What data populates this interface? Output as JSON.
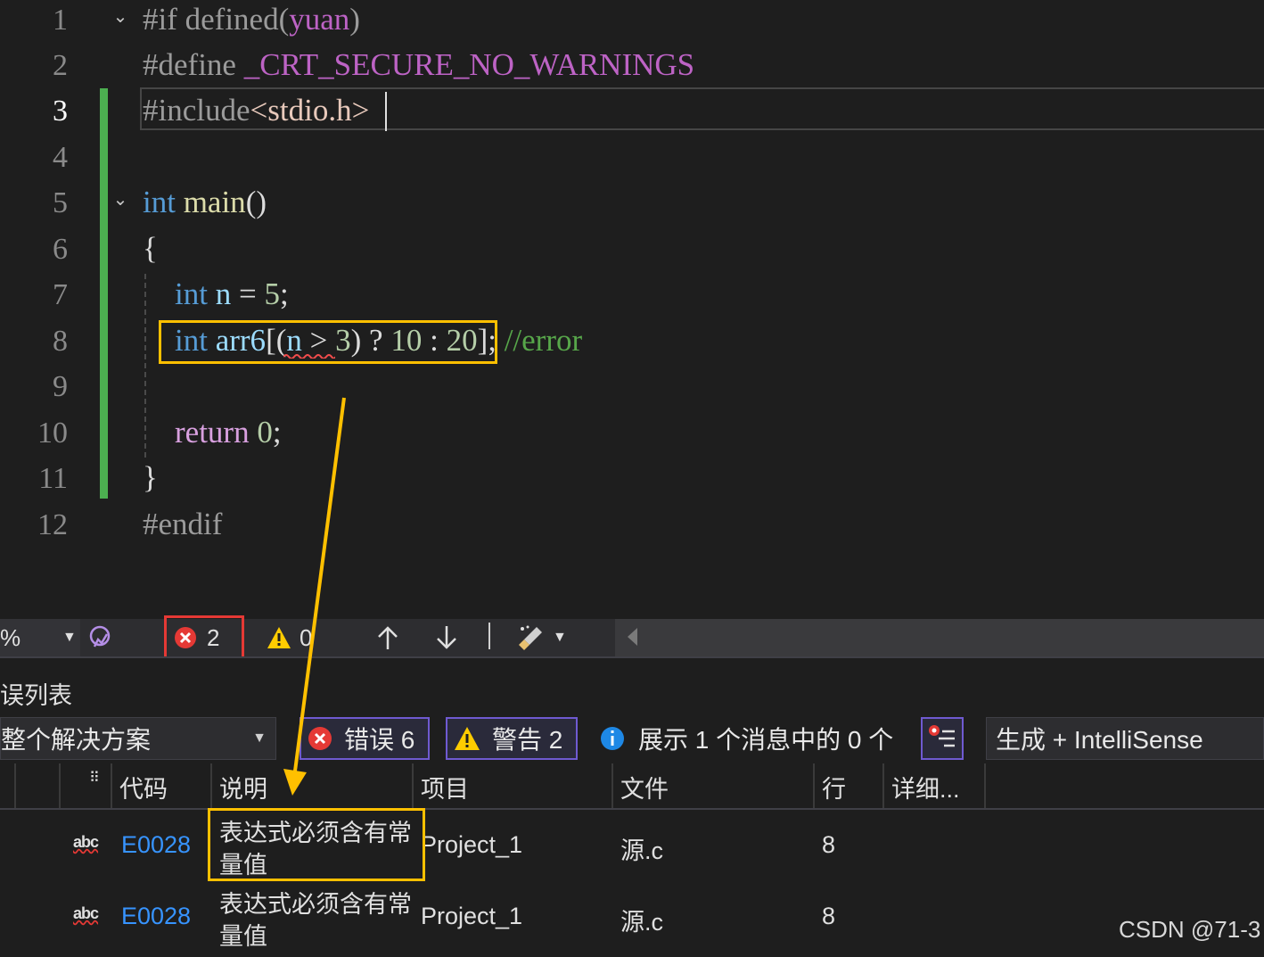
{
  "editor": {
    "lines": [
      {
        "num": "1",
        "tokens": [
          {
            "t": "#if defined(",
            "c": "c-pre"
          },
          {
            "t": "yuan",
            "c": "c-macro"
          },
          {
            "t": ")",
            "c": "c-pre"
          }
        ]
      },
      {
        "num": "2",
        "tokens": [
          {
            "t": "#define ",
            "c": "c-pre"
          },
          {
            "t": "_CRT_SECURE_NO_WARNINGS",
            "c": "c-macro"
          }
        ]
      },
      {
        "num": "3",
        "tokens": [
          {
            "t": "#include",
            "c": "c-pre"
          },
          {
            "t": "<stdio.h>",
            "c": "c-str"
          }
        ]
      },
      {
        "num": "4",
        "tokens": []
      },
      {
        "num": "5",
        "tokens": [
          {
            "t": "int",
            "c": "c-kw"
          },
          {
            "t": " ",
            "c": "c-plain"
          },
          {
            "t": "main",
            "c": "c-fn"
          },
          {
            "t": "()",
            "c": "c-plain"
          }
        ]
      },
      {
        "num": "6",
        "tokens": [
          {
            "t": "{",
            "c": "c-plain"
          }
        ]
      },
      {
        "num": "7",
        "tokens": [
          {
            "t": "int",
            "c": "c-kw"
          },
          {
            "t": " ",
            "c": "c-plain"
          },
          {
            "t": "n",
            "c": "c-var"
          },
          {
            "t": " = ",
            "c": "c-plain"
          },
          {
            "t": "5",
            "c": "c-num"
          },
          {
            "t": ";",
            "c": "c-plain"
          }
        ]
      },
      {
        "num": "8",
        "tokens": [
          {
            "t": "int",
            "c": "c-kw"
          },
          {
            "t": " ",
            "c": "c-plain"
          },
          {
            "t": "arr6",
            "c": "c-var"
          },
          {
            "t": "[(",
            "c": "c-plain"
          },
          {
            "t": "n",
            "c": "c-var"
          },
          {
            "t": " > ",
            "c": "c-plain"
          },
          {
            "t": "3",
            "c": "c-num"
          },
          {
            "t": ") ? ",
            "c": "c-plain"
          },
          {
            "t": "10",
            "c": "c-num"
          },
          {
            "t": " : ",
            "c": "c-plain"
          },
          {
            "t": "20",
            "c": "c-num"
          },
          {
            "t": "]; ",
            "c": "c-plain"
          },
          {
            "t": "//error",
            "c": "c-cmt"
          }
        ]
      },
      {
        "num": "9",
        "tokens": []
      },
      {
        "num": "10",
        "tokens": [
          {
            "t": "return",
            "c": "c-ret"
          },
          {
            "t": " ",
            "c": "c-plain"
          },
          {
            "t": "0",
            "c": "c-num"
          },
          {
            "t": ";",
            "c": "c-plain"
          }
        ]
      },
      {
        "num": "11",
        "tokens": [
          {
            "t": "}",
            "c": "c-plain"
          }
        ]
      },
      {
        "num": "12",
        "tokens": [
          {
            "t": "#endif",
            "c": "c-pre"
          }
        ]
      }
    ],
    "active_line": "3"
  },
  "statusbar": {
    "zoom": "%",
    "error_count": "2",
    "warning_count": "0"
  },
  "errorlist": {
    "title": "误列表",
    "scope": "整个解决方案",
    "errors_label": "错误 6",
    "warnings_label": "警告 2",
    "messages_label": "展示 1 个消息中的 0 个",
    "build_filter": "生成 + IntelliSense",
    "columns": {
      "code": "代码",
      "desc": "说明",
      "project": "项目",
      "file": "文件",
      "line": "行",
      "detail": "详细..."
    },
    "rows": [
      {
        "icon": "abc",
        "code": "E0028",
        "desc1": "表达式必须含有常",
        "desc2": "量值",
        "project": "Project_1",
        "file": "源.c",
        "line": "8"
      },
      {
        "icon": "abc",
        "code": "E0028",
        "desc1": "表达式必须含有常",
        "desc2": "量值",
        "project": "Project_1",
        "file": "源.c",
        "line": "8"
      }
    ]
  },
  "watermark": "CSDN @71-3",
  "colors": {
    "accent_error": "#e53935",
    "highlight": "#ffc000",
    "link": "#3794ff",
    "gutter_changed": "#4caf50"
  }
}
